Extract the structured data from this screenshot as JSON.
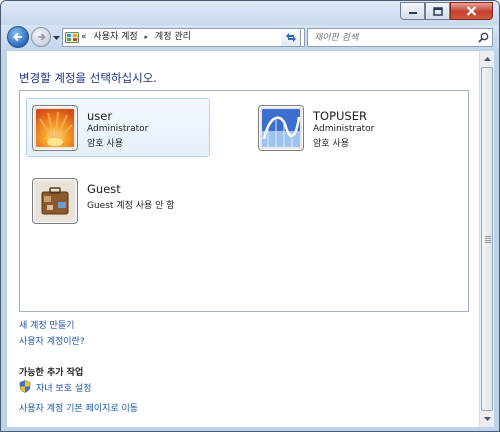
{
  "window": {
    "caption_buttons": [
      {
        "name": "minimize",
        "icon": "minimize-icon"
      },
      {
        "name": "maximize",
        "icon": "maximize-icon"
      },
      {
        "name": "close",
        "icon": "close-icon"
      }
    ]
  },
  "nav": {
    "breadcrumb": {
      "overflow": "«",
      "items": [
        "사용자 계정",
        "계정 관리"
      ],
      "separator": "▸"
    },
    "search_placeholder": "제어판 검색"
  },
  "main": {
    "heading": "변경할 계정을 선택하십시오.",
    "accounts": [
      {
        "name": "user",
        "role": "Administrator",
        "status": "암호 사용",
        "picture": "orange-flower-picture",
        "selected": true
      },
      {
        "name": "TOPUSER",
        "role": "Administrator",
        "status": "암호 사용",
        "picture": "roller-coaster-picture",
        "selected": false
      },
      {
        "name": "Guest",
        "role": "",
        "status": "Guest 계정 사용 안 함",
        "picture": "suitcase-picture",
        "selected": false
      }
    ],
    "links": {
      "create_account": "새 계정 만들기",
      "what_is_account": "사용자 계정이란?"
    },
    "additional_tasks": {
      "heading": "가능한 추가 작업",
      "items": [
        {
          "label": "자녀 보호 설정",
          "icon": "uac-shield-icon"
        },
        {
          "label": "사용자 계정 기본 페이지로 이동",
          "icon": ""
        }
      ]
    }
  },
  "colors": {
    "heading": "#1e3287",
    "link": "#1e57ab",
    "selected_bg": "#e6f0fa",
    "selected_border": "#b4d2f0"
  }
}
